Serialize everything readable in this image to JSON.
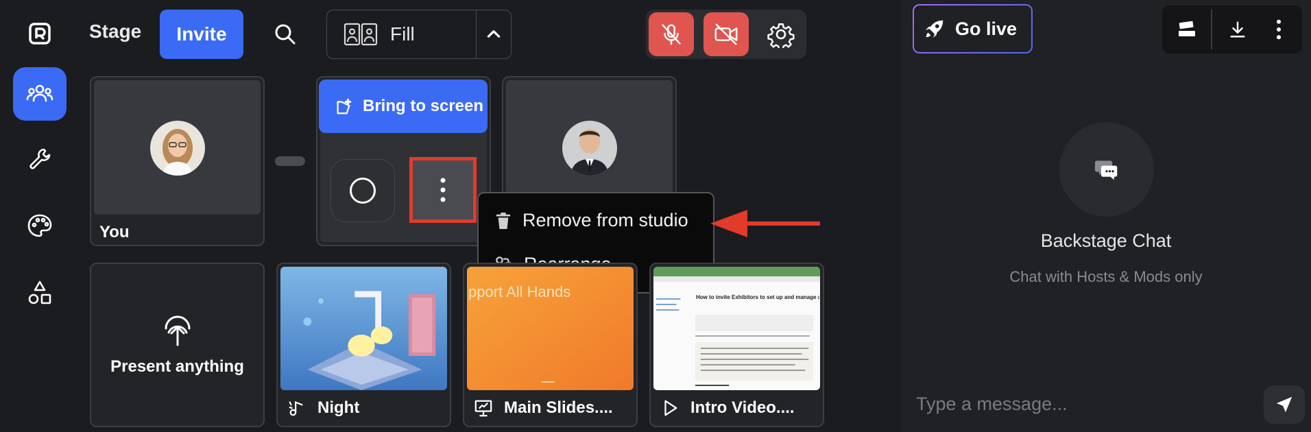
{
  "topbar": {
    "stage_label": "Stage",
    "invite_label": "Invite",
    "layout_label": "Fill"
  },
  "tiles": {
    "you_label": "You"
  },
  "bring_to_screen_label": "Bring to screen",
  "context_menu": {
    "items": [
      {
        "label": "Remove from studio"
      },
      {
        "label": "Rearrange"
      }
    ]
  },
  "media": [
    {
      "label": "Present anything"
    },
    {
      "label": "Night"
    },
    {
      "label": "Main Slides...."
    },
    {
      "label": "Intro Video...."
    }
  ],
  "slide_text": "pport All Hands",
  "doc_title": "How to invite Exhibitors to set up and manage an Expo Booth",
  "right_panel": {
    "go_live_label": "Go live",
    "chat_title": "Backstage Chat",
    "chat_subtitle": "Chat with Hosts & Mods only",
    "message_placeholder": "Type a message..."
  },
  "colors": {
    "accent": "#3b6bf5",
    "danger": "#e0554f",
    "highlight": "#e23b2a"
  }
}
